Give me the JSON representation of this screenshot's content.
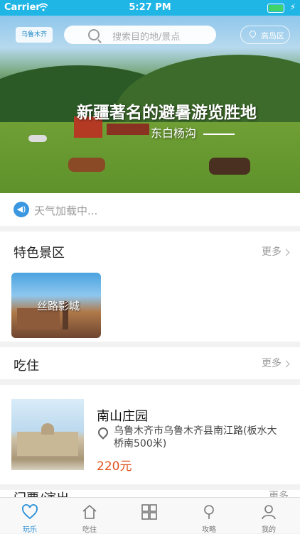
{
  "status_bar": {
    "carrier": "Carrier",
    "time": "5:27 PM"
  },
  "header": {
    "logo_text": "乌鲁木齐",
    "search_placeholder": "搜索目的地/景点",
    "region": "高岛区"
  },
  "banner": {
    "title": "新疆著名的避暑游览胜地",
    "subtitle": "东白杨沟"
  },
  "weather": {
    "text": "天气加载中..."
  },
  "featured": {
    "title": "特色景区",
    "more": "更多",
    "items": [
      {
        "label": "丝路影城"
      }
    ]
  },
  "eat_stay": {
    "title": "吃住",
    "more": "更多"
  },
  "hotel": {
    "name": "南山庄园",
    "address": "乌鲁木齐市乌鲁木齐县南江路(板水大桥南500米)",
    "price": "220元"
  },
  "tickets": {
    "title": "门票/演出",
    "more": "更多"
  },
  "tabbar": [
    {
      "label": "玩乐",
      "icon": "heart-icon",
      "active": true
    },
    {
      "label": "吃住",
      "icon": "home-icon",
      "active": false
    },
    {
      "label": "",
      "icon": "grid-icon",
      "active": false
    },
    {
      "label": "攻略",
      "icon": "pin-icon",
      "active": false
    },
    {
      "label": "我的",
      "icon": "user-icon",
      "active": false
    }
  ],
  "colors": {
    "accent": "#2b8fd8",
    "status_bar": "#1fb6e6",
    "price": "#e0531f"
  }
}
